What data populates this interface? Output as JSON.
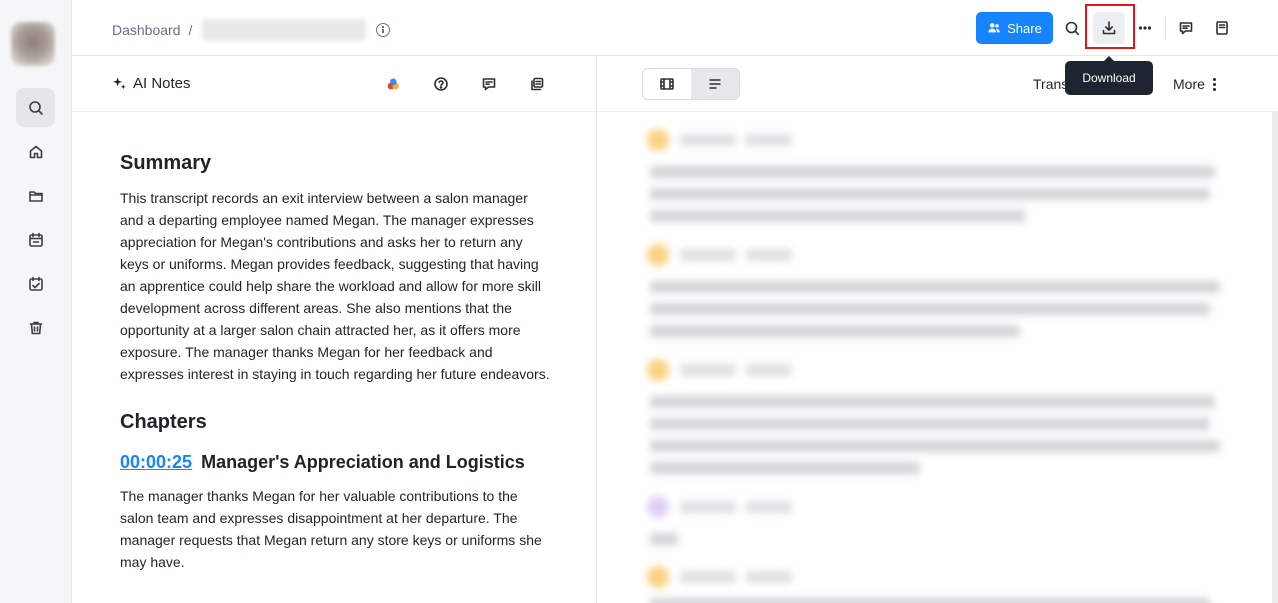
{
  "header": {
    "breadcrumb_root": "Dashboard",
    "breadcrumb_sep": "/",
    "share_label": "Share",
    "tooltip": "Download"
  },
  "notes": {
    "title": "AI Notes",
    "summary_heading": "Summary",
    "summary_text": "This transcript records an exit interview between a salon manager and a departing employee named Megan. The manager expresses appreciation for Megan's contributions and asks her to return any keys or uniforms. Megan provides feedback, suggesting that having an apprentice could help share the workload and allow for more skill development across different areas. She also mentions that the opportunity at a larger salon chain attracted her, as it offers more exposure. The manager thanks Megan for her feedback and expresses interest in staying in touch regarding her future endeavors.",
    "chapters_heading": "Chapters",
    "chapters": [
      {
        "time": "00:00:25",
        "title": "Manager's Appreciation and Logistics",
        "text": "The manager thanks Megan for her valuable contributions to the salon team and expresses disappointment at her departure. The manager requests that Megan return any store keys or uniforms she may have."
      }
    ]
  },
  "transcript": {
    "label": "Trans",
    "more_label": "More"
  },
  "colors": {
    "accent": "#1684fc",
    "highlight_box": "#e0161b",
    "tooltip_bg": "#1e2430"
  }
}
